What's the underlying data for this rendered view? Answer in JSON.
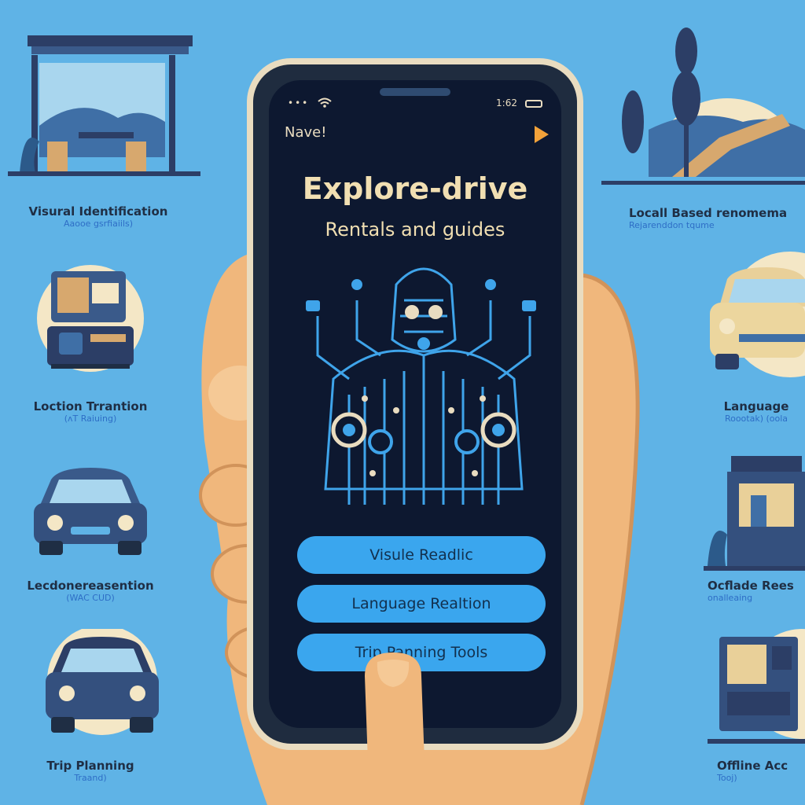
{
  "left_features": [
    {
      "title": "Visural Identification",
      "subtitle": "Aaooe gsrfiaiils)"
    },
    {
      "title": "Loction Trrantion",
      "subtitle": "(ʌT Raiuing)"
    },
    {
      "title": "Lecdonereasention",
      "subtitle": "(WAC CUD)"
    },
    {
      "title": "Trip Planning",
      "subtitle": "Traand)"
    }
  ],
  "right_features": [
    {
      "title": "Locall Based renomema",
      "subtitle": "Rejarenddon tqume"
    },
    {
      "title": "Language",
      "subtitle": "Roootak) (oola"
    },
    {
      "title": "Ocflade Rees",
      "subtitle": "onalleaing"
    },
    {
      "title": "Offline Acc",
      "subtitle": "Tooj)"
    }
  ],
  "phone": {
    "status_time": "1:62",
    "nav_title": "Nave!",
    "app_title": "Explore-drive",
    "app_subtitle": "Rentals  and guides",
    "buttons": [
      "Visule Readlic",
      "Language Realtion",
      "Trip Panning Tools"
    ]
  },
  "colors": {
    "background": "#5fb3e6",
    "button": "#3aa6ee",
    "accent": "#f2a23a",
    "phone_frame": "#e9dcc0"
  },
  "icons": [
    "wifi-icon",
    "battery-icon",
    "play-icon",
    "robot-illustration",
    "hand-illustration",
    "car-icon",
    "building-icon"
  ]
}
